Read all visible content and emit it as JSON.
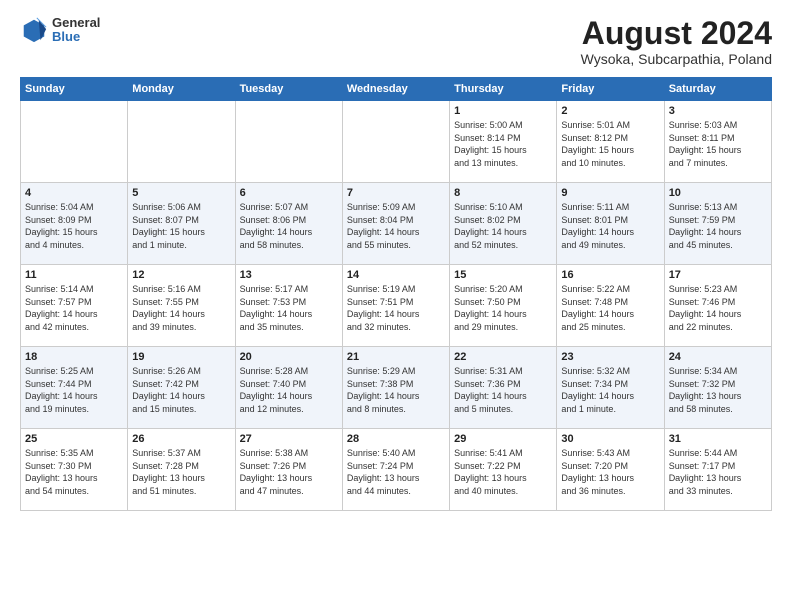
{
  "header": {
    "logo_general": "General",
    "logo_blue": "Blue",
    "month_year": "August 2024",
    "location": "Wysoka, Subcarpathia, Poland"
  },
  "days_of_week": [
    "Sunday",
    "Monday",
    "Tuesday",
    "Wednesday",
    "Thursday",
    "Friday",
    "Saturday"
  ],
  "weeks": [
    [
      {
        "day": "",
        "info": ""
      },
      {
        "day": "",
        "info": ""
      },
      {
        "day": "",
        "info": ""
      },
      {
        "day": "",
        "info": ""
      },
      {
        "day": "1",
        "info": "Sunrise: 5:00 AM\nSunset: 8:14 PM\nDaylight: 15 hours\nand 13 minutes."
      },
      {
        "day": "2",
        "info": "Sunrise: 5:01 AM\nSunset: 8:12 PM\nDaylight: 15 hours\nand 10 minutes."
      },
      {
        "day": "3",
        "info": "Sunrise: 5:03 AM\nSunset: 8:11 PM\nDaylight: 15 hours\nand 7 minutes."
      }
    ],
    [
      {
        "day": "4",
        "info": "Sunrise: 5:04 AM\nSunset: 8:09 PM\nDaylight: 15 hours\nand 4 minutes."
      },
      {
        "day": "5",
        "info": "Sunrise: 5:06 AM\nSunset: 8:07 PM\nDaylight: 15 hours\nand 1 minute."
      },
      {
        "day": "6",
        "info": "Sunrise: 5:07 AM\nSunset: 8:06 PM\nDaylight: 14 hours\nand 58 minutes."
      },
      {
        "day": "7",
        "info": "Sunrise: 5:09 AM\nSunset: 8:04 PM\nDaylight: 14 hours\nand 55 minutes."
      },
      {
        "day": "8",
        "info": "Sunrise: 5:10 AM\nSunset: 8:02 PM\nDaylight: 14 hours\nand 52 minutes."
      },
      {
        "day": "9",
        "info": "Sunrise: 5:11 AM\nSunset: 8:01 PM\nDaylight: 14 hours\nand 49 minutes."
      },
      {
        "day": "10",
        "info": "Sunrise: 5:13 AM\nSunset: 7:59 PM\nDaylight: 14 hours\nand 45 minutes."
      }
    ],
    [
      {
        "day": "11",
        "info": "Sunrise: 5:14 AM\nSunset: 7:57 PM\nDaylight: 14 hours\nand 42 minutes."
      },
      {
        "day": "12",
        "info": "Sunrise: 5:16 AM\nSunset: 7:55 PM\nDaylight: 14 hours\nand 39 minutes."
      },
      {
        "day": "13",
        "info": "Sunrise: 5:17 AM\nSunset: 7:53 PM\nDaylight: 14 hours\nand 35 minutes."
      },
      {
        "day": "14",
        "info": "Sunrise: 5:19 AM\nSunset: 7:51 PM\nDaylight: 14 hours\nand 32 minutes."
      },
      {
        "day": "15",
        "info": "Sunrise: 5:20 AM\nSunset: 7:50 PM\nDaylight: 14 hours\nand 29 minutes."
      },
      {
        "day": "16",
        "info": "Sunrise: 5:22 AM\nSunset: 7:48 PM\nDaylight: 14 hours\nand 25 minutes."
      },
      {
        "day": "17",
        "info": "Sunrise: 5:23 AM\nSunset: 7:46 PM\nDaylight: 14 hours\nand 22 minutes."
      }
    ],
    [
      {
        "day": "18",
        "info": "Sunrise: 5:25 AM\nSunset: 7:44 PM\nDaylight: 14 hours\nand 19 minutes."
      },
      {
        "day": "19",
        "info": "Sunrise: 5:26 AM\nSunset: 7:42 PM\nDaylight: 14 hours\nand 15 minutes."
      },
      {
        "day": "20",
        "info": "Sunrise: 5:28 AM\nSunset: 7:40 PM\nDaylight: 14 hours\nand 12 minutes."
      },
      {
        "day": "21",
        "info": "Sunrise: 5:29 AM\nSunset: 7:38 PM\nDaylight: 14 hours\nand 8 minutes."
      },
      {
        "day": "22",
        "info": "Sunrise: 5:31 AM\nSunset: 7:36 PM\nDaylight: 14 hours\nand 5 minutes."
      },
      {
        "day": "23",
        "info": "Sunrise: 5:32 AM\nSunset: 7:34 PM\nDaylight: 14 hours\nand 1 minute."
      },
      {
        "day": "24",
        "info": "Sunrise: 5:34 AM\nSunset: 7:32 PM\nDaylight: 13 hours\nand 58 minutes."
      }
    ],
    [
      {
        "day": "25",
        "info": "Sunrise: 5:35 AM\nSunset: 7:30 PM\nDaylight: 13 hours\nand 54 minutes."
      },
      {
        "day": "26",
        "info": "Sunrise: 5:37 AM\nSunset: 7:28 PM\nDaylight: 13 hours\nand 51 minutes."
      },
      {
        "day": "27",
        "info": "Sunrise: 5:38 AM\nSunset: 7:26 PM\nDaylight: 13 hours\nand 47 minutes."
      },
      {
        "day": "28",
        "info": "Sunrise: 5:40 AM\nSunset: 7:24 PM\nDaylight: 13 hours\nand 44 minutes."
      },
      {
        "day": "29",
        "info": "Sunrise: 5:41 AM\nSunset: 7:22 PM\nDaylight: 13 hours\nand 40 minutes."
      },
      {
        "day": "30",
        "info": "Sunrise: 5:43 AM\nSunset: 7:20 PM\nDaylight: 13 hours\nand 36 minutes."
      },
      {
        "day": "31",
        "info": "Sunrise: 5:44 AM\nSunset: 7:17 PM\nDaylight: 13 hours\nand 33 minutes."
      }
    ]
  ]
}
